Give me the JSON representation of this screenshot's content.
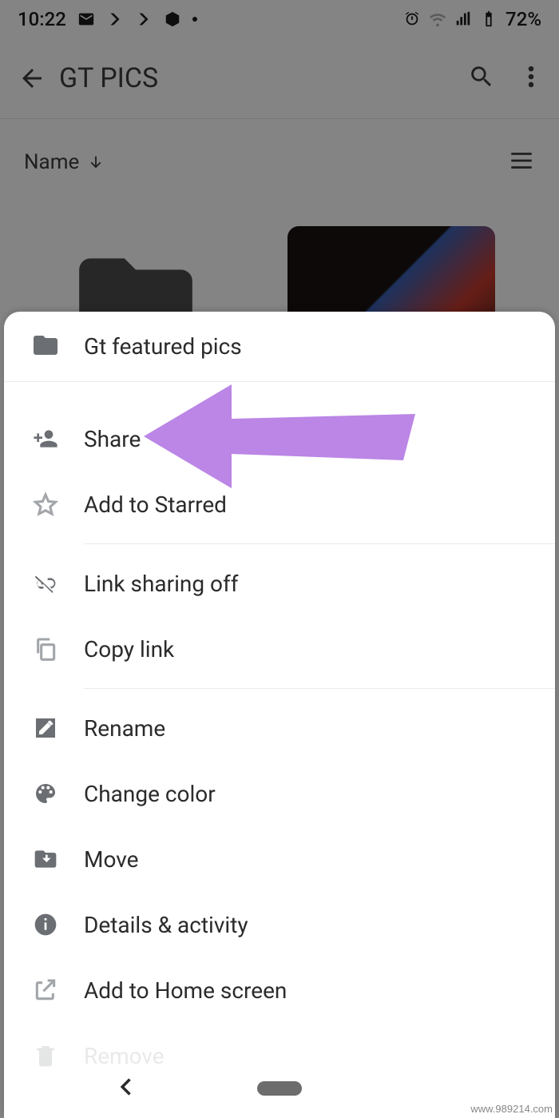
{
  "statusbar": {
    "time": "10:22",
    "battery_text": "72%"
  },
  "appbar": {
    "title": "GT PICS"
  },
  "sort": {
    "label": "Name"
  },
  "sheet": {
    "folder_name": "Gt featured pics"
  },
  "menu": {
    "share": "Share",
    "starred": "Add to Starred",
    "link_sharing": "Link sharing off",
    "copy_link": "Copy link",
    "rename": "Rename",
    "change_color": "Change color",
    "move": "Move",
    "details": "Details & activity",
    "add_home": "Add to Home screen",
    "remove": "Remove"
  },
  "watermark": "www.989214.com"
}
